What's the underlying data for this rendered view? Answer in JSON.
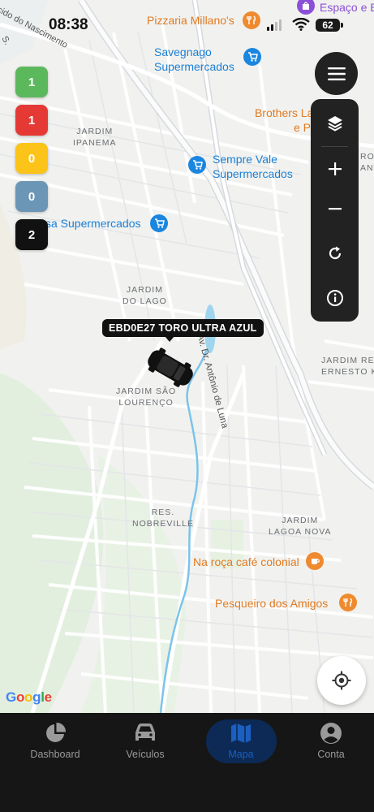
{
  "status_bar": {
    "time": "08:38",
    "battery": "62"
  },
  "map": {
    "pois": {
      "pizzaria": "Pizzaria Millano's",
      "savegnago": [
        "Savegnago",
        "Supermercados"
      ],
      "brothers": [
        "Brothers La",
        "e P"
      ],
      "sempre_vale": [
        "Sempre Vale",
        "Supermercados"
      ],
      "isa_super": "sa Supermercados",
      "espaco": "Espaço e B",
      "roca": "Na roça café colonial",
      "pesqueiro": "Pesqueiro dos Amigos",
      "right_edge_1": "ROQU",
      "right_edge_2": "ANTA"
    },
    "districts": {
      "ipanema": [
        "JARDIM",
        "IPANEMA"
      ],
      "lago": [
        "JARDIM",
        "DO LAGO"
      ],
      "sao_lourenco": [
        "JARDIM SÃO",
        "LOURENÇO"
      ],
      "nobreville": [
        "RES.",
        "NOBREVILLE"
      ],
      "lagoa_nova": [
        "JARDIM",
        "LAGOA NOVA"
      ],
      "jardim_re": [
        "JARDIM RE",
        "ERNESTO KU"
      ]
    },
    "streets": {
      "nascimento": "cido do Nascimento",
      "avenida": "Av. Dr. Antônio de Luna",
      "edge_s": "S."
    },
    "attribution": "Google"
  },
  "counters": [
    {
      "value": "1",
      "color": "#5cb85c"
    },
    {
      "value": "1",
      "color": "#e53935"
    },
    {
      "value": "0",
      "color": "#fcc419"
    },
    {
      "value": "0",
      "color": "#6b96b5"
    },
    {
      "value": "2",
      "color": "#111111"
    }
  ],
  "vehicle": {
    "label": "EBD0E27 TORO ULTRA AZUL"
  },
  "nav": [
    {
      "label": "Dashboard",
      "icon": "pie-chart-icon",
      "active": false
    },
    {
      "label": "Veículos",
      "icon": "car-icon",
      "active": false
    },
    {
      "label": "Mapa",
      "icon": "map-icon",
      "active": true
    },
    {
      "label": "Conta",
      "icon": "account-icon",
      "active": false
    }
  ],
  "colors": {
    "active_nav": "#1b5fc1",
    "nav_bg": "#161616",
    "control_bg": "#222222"
  }
}
